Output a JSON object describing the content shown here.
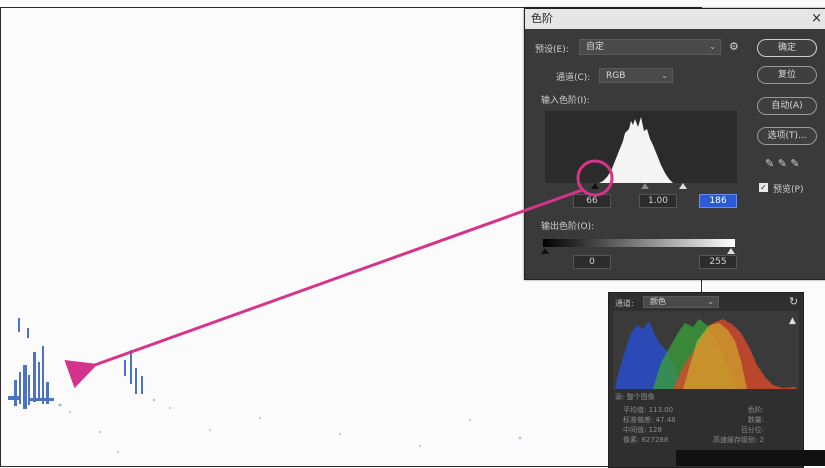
{
  "levels_dialog": {
    "title": "色阶",
    "close_glyph": "×",
    "preset_label": "预设(E):",
    "preset_value": "自定",
    "channel_label": "通道(C):",
    "channel_value": "RGB",
    "input_levels_label": "输入色阶(I):",
    "output_levels_label": "输出色阶(O):",
    "input_black": "66",
    "input_gamma": "1.00",
    "input_white": "186",
    "output_black": "0",
    "output_white": "255",
    "buttons": {
      "ok": "确定",
      "reset": "复位",
      "auto": "自动(A)",
      "options": "选项(T)..."
    },
    "preview_label": "预览(P)",
    "preview_checked": true,
    "eyedropper_glyphs": "✎ ✎ ✎",
    "gear_glyph": "⚙"
  },
  "histogram_panel": {
    "channel_label": "通道:",
    "channel_value": "颜色",
    "refresh_glyph": "↻",
    "warning_glyph": "▲",
    "source_label": "源: 整个图像",
    "stats_left": [
      "平均值: 113.00",
      "标准偏差: 47.48",
      "中间值: 128",
      "像素: 627288"
    ],
    "stats_right": [
      "色阶:",
      "数量:",
      "百分位:",
      "高速缓存级别: 2"
    ]
  },
  "colors": {
    "accent_magenta": "#d6338a",
    "dialog_bg": "#3a3a3a",
    "selected_field": "#2a5bd7"
  }
}
